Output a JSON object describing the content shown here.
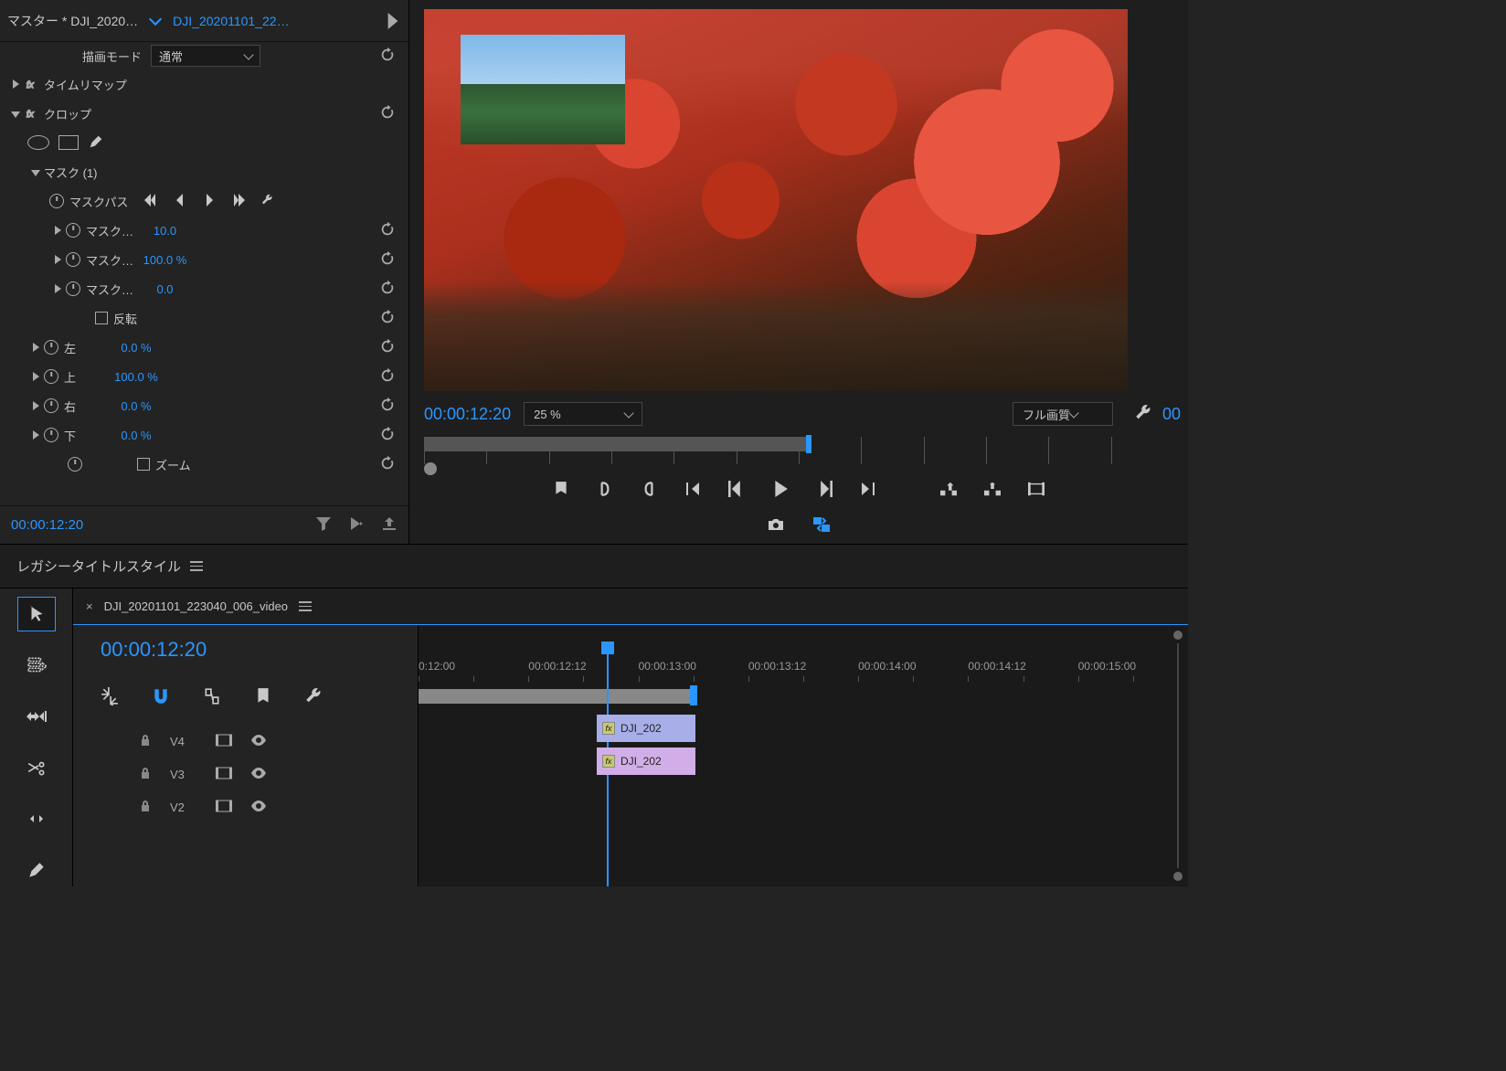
{
  "fx": {
    "tab_master": "マスター * DJI_2020…",
    "tab_clip": "DJI_20201101_22…",
    "blend_mode_label": "描画モード",
    "blend_mode_value": "通常",
    "time_remap": "タイムリマップ",
    "crop": "クロップ",
    "mask": "マスク (1)",
    "mask_path": "マスクパス",
    "mask_feather": "マスク…",
    "mask_feather_val": "10.0",
    "mask_opacity": "マスク…",
    "mask_opacity_val": "100.0 %",
    "mask_expansion": "マスク…",
    "mask_expansion_val": "0.0",
    "invert": "反転",
    "left": "左",
    "left_val": "0.0 %",
    "top": "上",
    "top_val": "100.0 %",
    "right": "右",
    "right_val": "0.0 %",
    "bottom": "下",
    "bottom_val": "0.0 %",
    "zoom": "ズーム",
    "footer_tc": "00:00:12:20"
  },
  "monitor": {
    "tc": "00:00:12:20",
    "zoom": "25 %",
    "quality": "フル画質",
    "tc_right": "00"
  },
  "titlestyles": "レガシータイトルスタイル",
  "timeline": {
    "seq_name": "DJI_20201101_223040_006_video",
    "tc": "00:00:12:20",
    "ruler": [
      "0:12:00",
      "00:00:12:12",
      "00:00:13:00",
      "00:00:13:12",
      "00:00:14:00",
      "00:00:14:12",
      "00:00:15:00"
    ],
    "tracks": [
      "V4",
      "V3",
      "V2"
    ],
    "clip_v3": "DJI_202",
    "clip_v2": "DJI_202"
  }
}
